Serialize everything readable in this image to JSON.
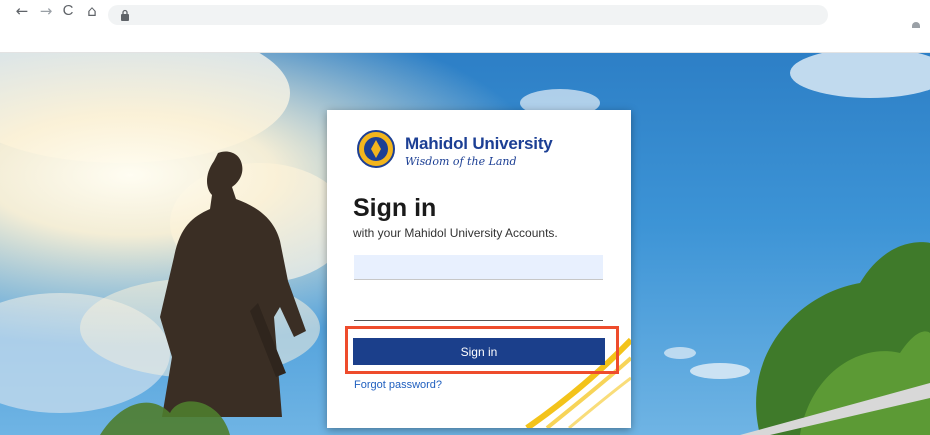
{
  "browser": {
    "back_icon": "←",
    "forward_icon": "→",
    "reload_icon": "C",
    "home_icon": "⌂",
    "address": ""
  },
  "brand": {
    "name": "Mahidol University",
    "tagline": "Wisdom of the Land",
    "color": "#1c3f94"
  },
  "form": {
    "heading": "Sign in",
    "subheading": "with your Mahidol University Accounts.",
    "username_value": "",
    "password_value": "",
    "submit_label": "Sign in",
    "forgot_label": "Forgot password?"
  },
  "colors": {
    "button": "#1b3f8b",
    "highlight": "#ee4c2c",
    "link": "#1f5fbf"
  }
}
